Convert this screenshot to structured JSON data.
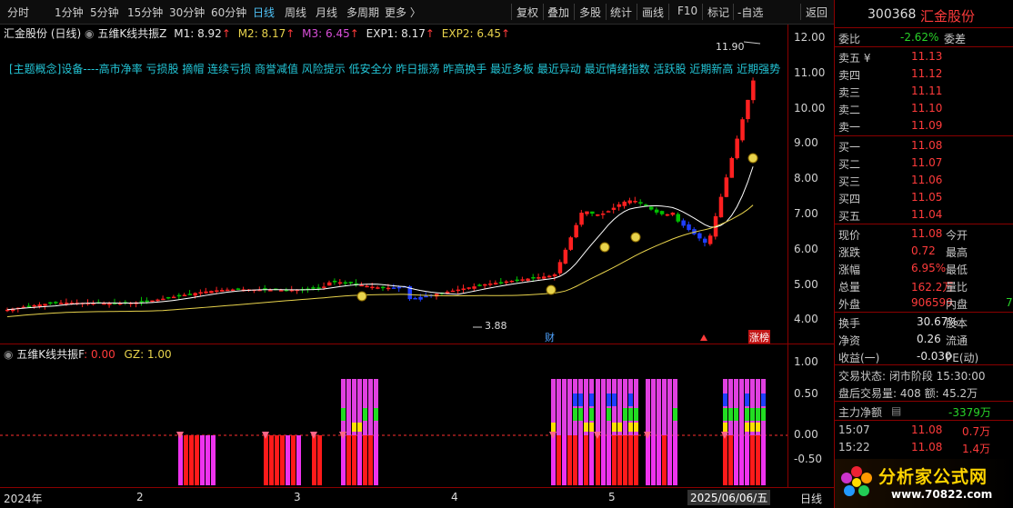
{
  "toolbar": {
    "periods": [
      "分时",
      "1分钟",
      "5分钟",
      "15分钟",
      "30分钟",
      "60分钟",
      "日线",
      "周线",
      "月线",
      "多周期",
      "更多 〉"
    ],
    "active_period": "日线",
    "actions": [
      "复权",
      "叠加",
      "多股",
      "统计",
      "画线",
      "F10",
      "标记",
      "-自选",
      "返回"
    ]
  },
  "chart_header": {
    "title": "汇金股份 (日线)",
    "indicator": "五维K线共振Z",
    "m1": "M1: 8.92",
    "m2": "M2: 8.17",
    "m3": "M3: 6.45",
    "exp1": "EXP1: 8.17",
    "exp2": "EXP2: 6.45",
    "concepts": "[主题概念]设备----高市净率 亏损股 摘帽 连续亏损 商誉减值 风险提示 低安全分 昨日振荡 昨高换手 最近多板 最近异动 最近情绪指数 活跃股 近期新高 近期强势"
  },
  "annotations": {
    "high": "11.90",
    "low": "3.88",
    "fin_tag": "财",
    "zt_tag": "涨榜"
  },
  "sub_header": {
    "name": "五维K线共振F",
    "f_val": ": 0.00",
    "gz": "GZ: 1.00"
  },
  "price_axis": [
    "12.00",
    "11.00",
    "10.00",
    "9.00",
    "8.00",
    "7.00",
    "6.00",
    "5.00",
    "4.00"
  ],
  "sub_axis": [
    "1.00",
    "0.50",
    "0.00",
    "-0.50"
  ],
  "date_axis": {
    "year": "2024年",
    "months": [
      "2",
      "3",
      "4",
      "5"
    ],
    "cursor": "2025/06/06/五",
    "period": "日线"
  },
  "panel": {
    "code": "300368",
    "name": "汇金股份",
    "weibi_label": "委比",
    "weibi": "-2.62%",
    "weicha_label": "委差",
    "asks": [
      {
        "label": "卖五 ¥",
        "price": "11.13"
      },
      {
        "label": "卖四",
        "price": "11.12"
      },
      {
        "label": "卖三",
        "price": "11.11"
      },
      {
        "label": "卖二",
        "price": "11.10"
      },
      {
        "label": "卖一",
        "price": "11.09"
      }
    ],
    "bids": [
      {
        "label": "买一",
        "price": "11.08"
      },
      {
        "label": "买二",
        "price": "11.07"
      },
      {
        "label": "买三",
        "price": "11.06"
      },
      {
        "label": "买四",
        "price": "11.05"
      },
      {
        "label": "买五",
        "price": "11.04"
      }
    ],
    "stats": [
      {
        "l1": "现价",
        "v1": "11.08",
        "l2": "今开",
        "v2": ""
      },
      {
        "l1": "涨跌",
        "v1": "0.72",
        "l2": "最高",
        "v2": ""
      },
      {
        "l1": "涨幅",
        "v1": "6.95%",
        "l2": "最低",
        "v2": ""
      },
      {
        "l1": "总量",
        "v1": "162.2万",
        "l2": "量比",
        "v2": ""
      },
      {
        "l1": "外盘",
        "v1": "906599",
        "l2": "内盘",
        "v2": "7"
      }
    ],
    "stats2": [
      {
        "l1": "换手",
        "v1": "30.67%",
        "l2": "股本"
      },
      {
        "l1": "净资",
        "v1": "0.26",
        "l2": "流通"
      },
      {
        "l1": "收益(一)",
        "v1": "-0.030",
        "l2": "PE(动)"
      }
    ],
    "trade_status": "交易状态: 闭市阶段 15:30:00",
    "after_hours": "盘后交易量: 408  额: 45.2万",
    "main_net_label": "主力净额",
    "main_net": "-3379万",
    "ticks": [
      {
        "time": "15:07",
        "price": "11.08",
        "vol": "0.7万"
      },
      {
        "time": "15:22",
        "price": "11.08",
        "vol": "1.4万"
      }
    ],
    "watermark": "分析家公式网",
    "watermark_url": "www.70822.com"
  }
}
